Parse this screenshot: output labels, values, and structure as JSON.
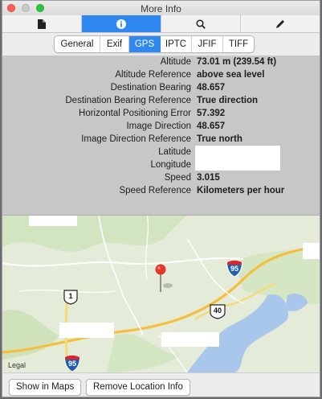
{
  "window": {
    "title": "More Info"
  },
  "toolbar": {
    "tabs": [
      "document",
      "info",
      "search",
      "edit"
    ],
    "active": "info"
  },
  "segments": {
    "items": [
      "General",
      "Exif",
      "GPS",
      "IPTC",
      "JFIF",
      "TIFF"
    ],
    "active": "GPS"
  },
  "gps": {
    "rows": [
      {
        "label": "Altitude",
        "value": "73.01 m (239.54 ft)"
      },
      {
        "label": "Altitude Reference",
        "value": "above sea level"
      },
      {
        "label": "Destination Bearing",
        "value": "48.657"
      },
      {
        "label": "Destination Bearing Reference",
        "value": "True direction"
      },
      {
        "label": "Horizontal Positioning Error",
        "value": "57.392"
      },
      {
        "label": "Image Direction",
        "value": "48.657"
      },
      {
        "label": "Image Direction Reference",
        "value": "True north"
      },
      {
        "label": "Latitude",
        "value": ""
      },
      {
        "label": "Longitude",
        "value": ""
      },
      {
        "label": "Speed",
        "value": "3.015"
      },
      {
        "label": "Speed Reference",
        "value": "Kilometers per hour"
      }
    ]
  },
  "map": {
    "shields": {
      "i95_top": "95",
      "i95_bottom": "95",
      "us1": "1",
      "us40": "40"
    },
    "legal": "Legal"
  },
  "buttons": {
    "show_in_maps": "Show in Maps",
    "remove_location": "Remove Location Info"
  }
}
